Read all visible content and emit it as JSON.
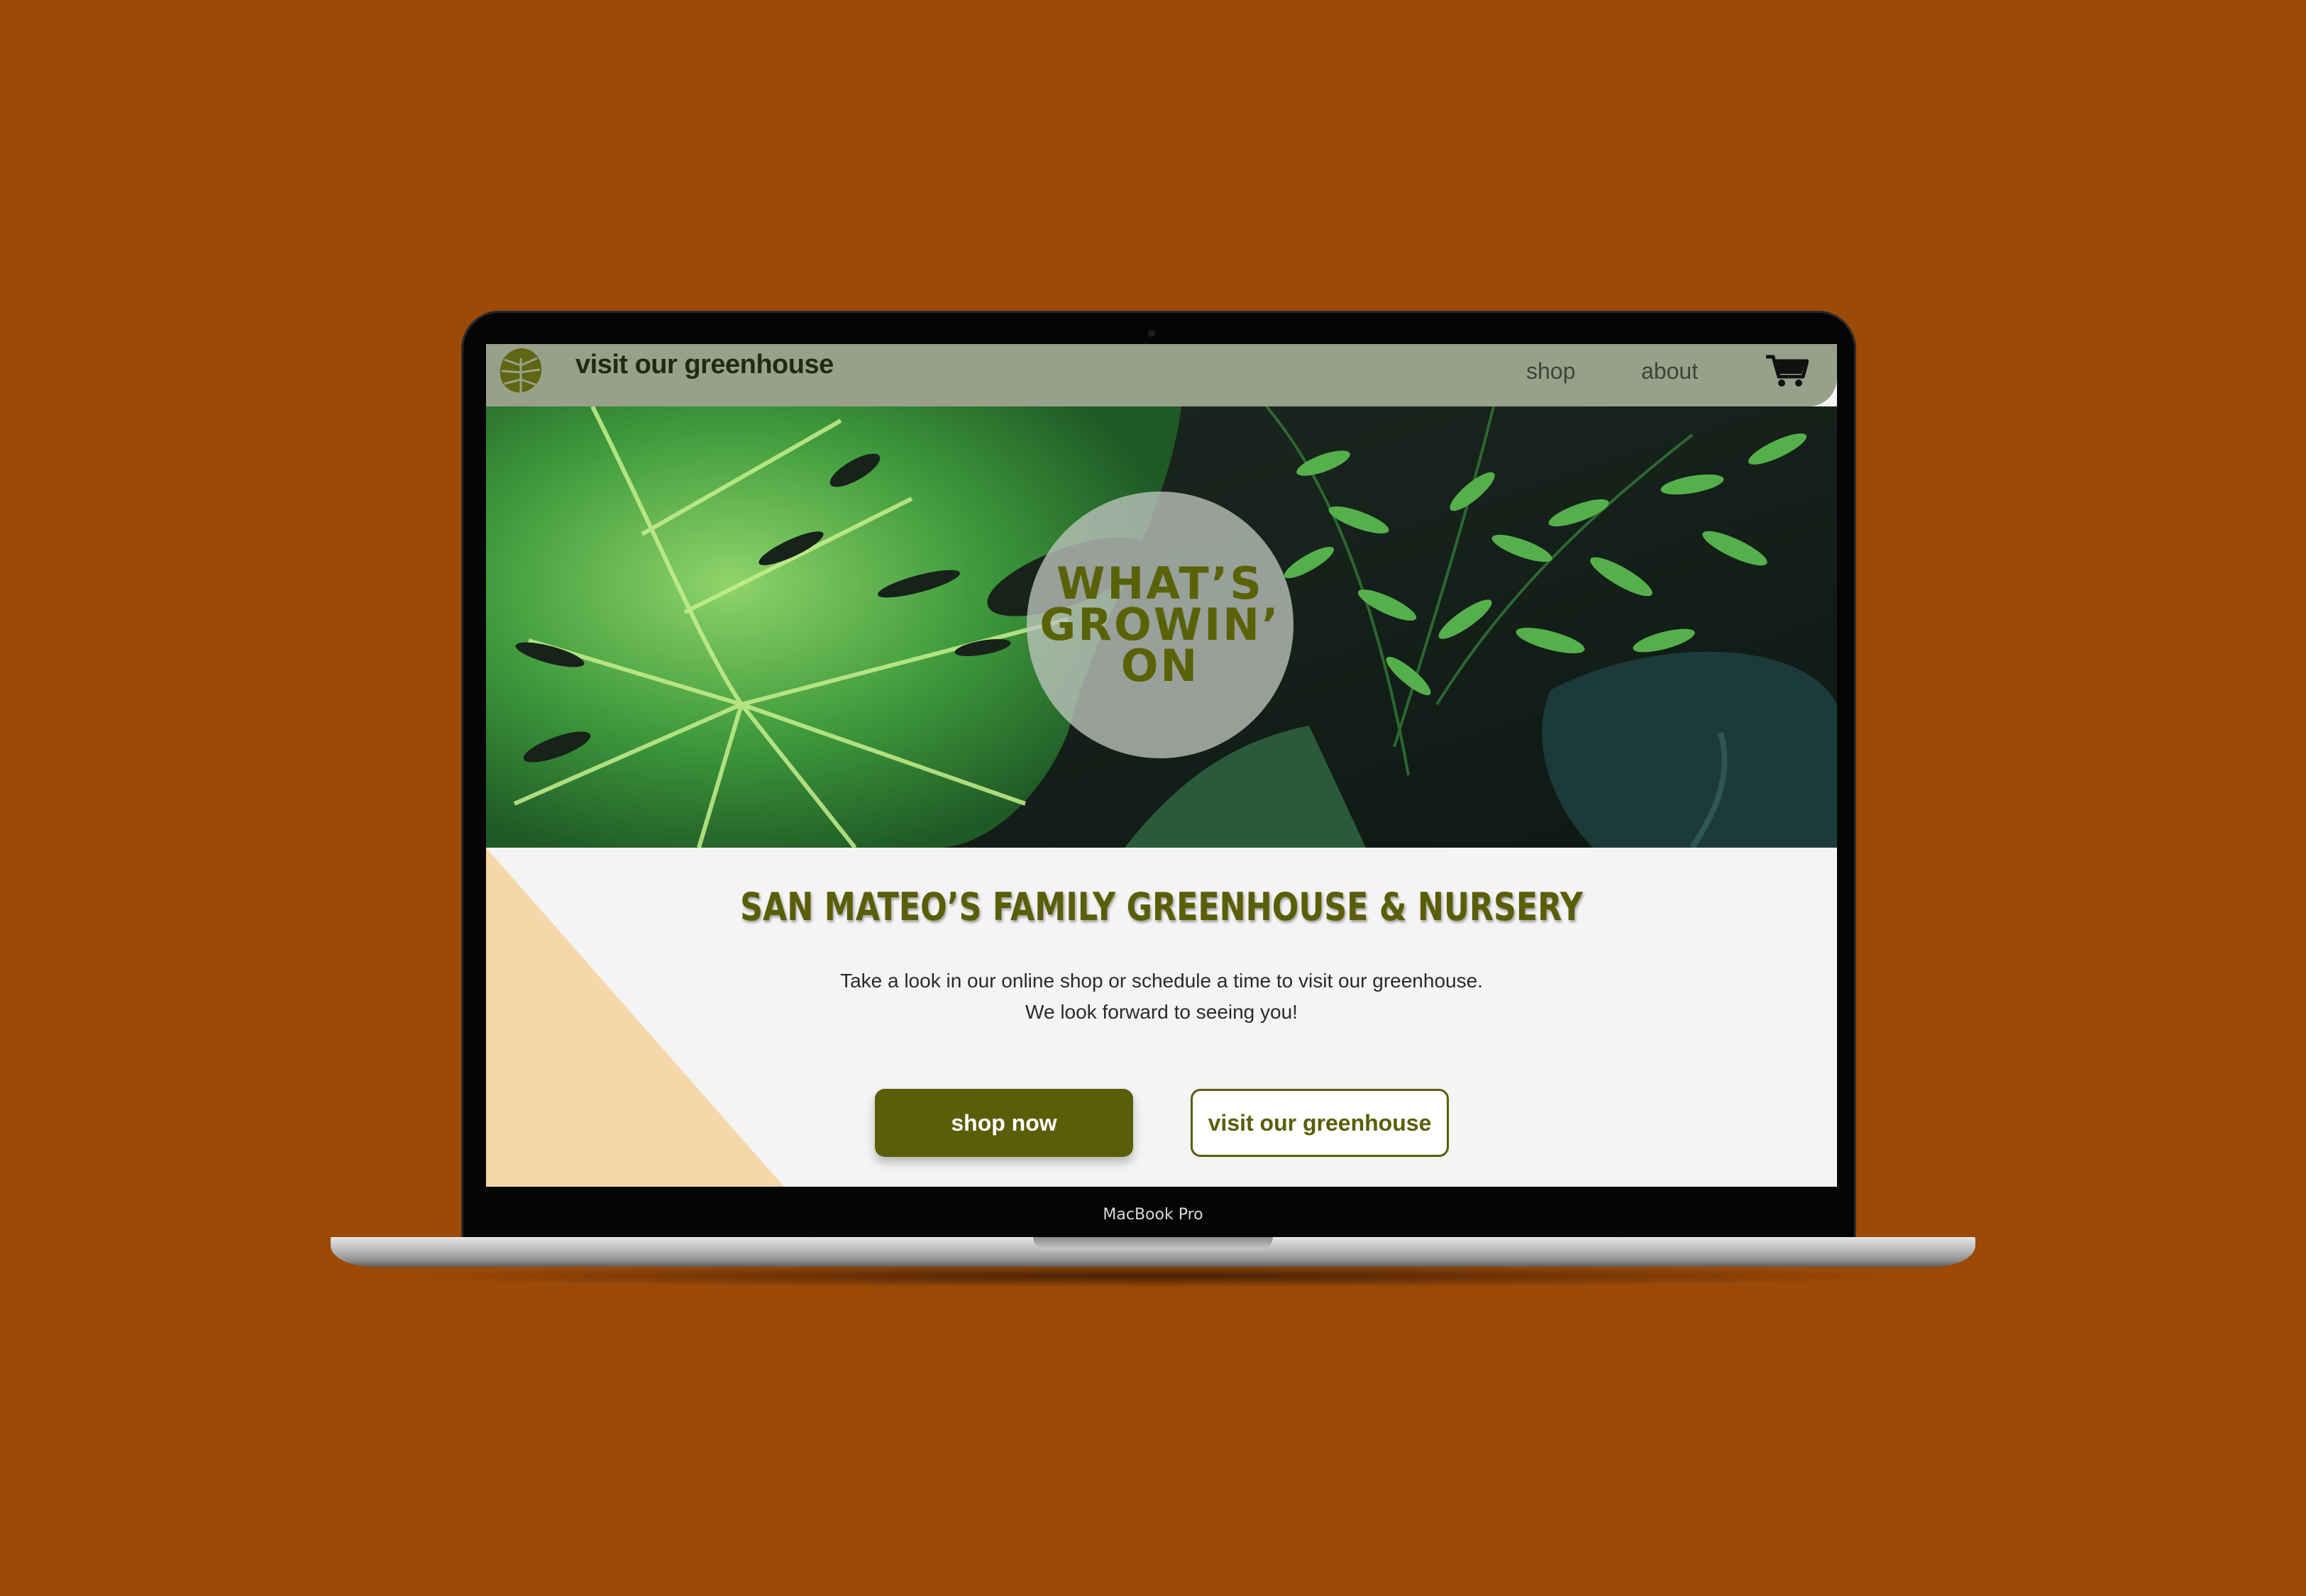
{
  "nav": {
    "brand": "visit our greenhouse",
    "links": [
      {
        "label": "shop"
      },
      {
        "label": "about"
      }
    ],
    "cart_icon": "cart-icon",
    "logo_icon": "monstera-leaf-icon"
  },
  "hero": {
    "badge_lines": [
      "WHAT’S",
      "GROWIN’",
      "ON"
    ]
  },
  "main": {
    "headline": "SAN MATEO’S FAMILY GREENHOUSE & NURSERY",
    "sub_line1": "Take a look in our online shop or schedule a time to visit our greenhouse.",
    "sub_line2": "We look forward to seeing you!",
    "primary_button": "shop now",
    "secondary_button": "visit our greenhouse"
  },
  "device": {
    "label": "MacBook Pro"
  },
  "colors": {
    "background": "#9d4a08",
    "nav": "#97a18a",
    "accent": "#5a5e08",
    "triangle": "#f5d7a9"
  }
}
